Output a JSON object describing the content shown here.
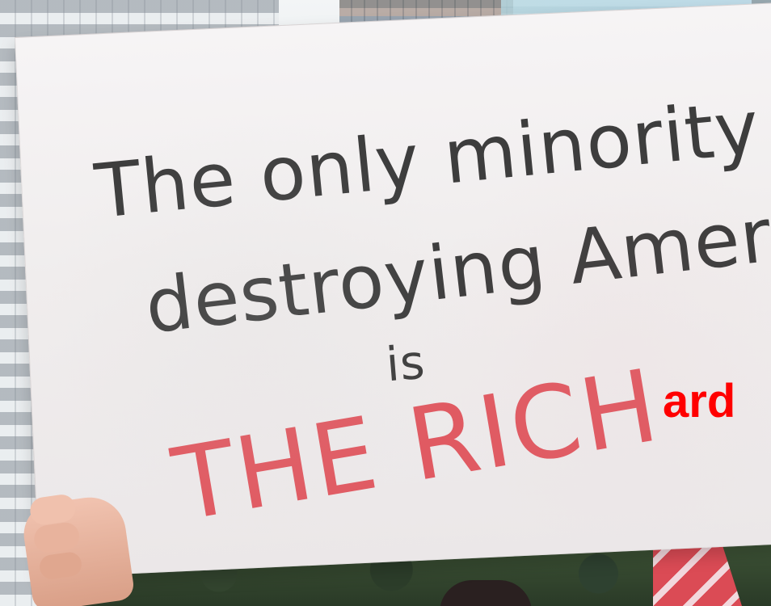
{
  "sign": {
    "line_1": "The only minority",
    "line_2": "destroying America",
    "line_3": "is",
    "line_4": "THE RICH"
  },
  "overlay_text": "ard"
}
